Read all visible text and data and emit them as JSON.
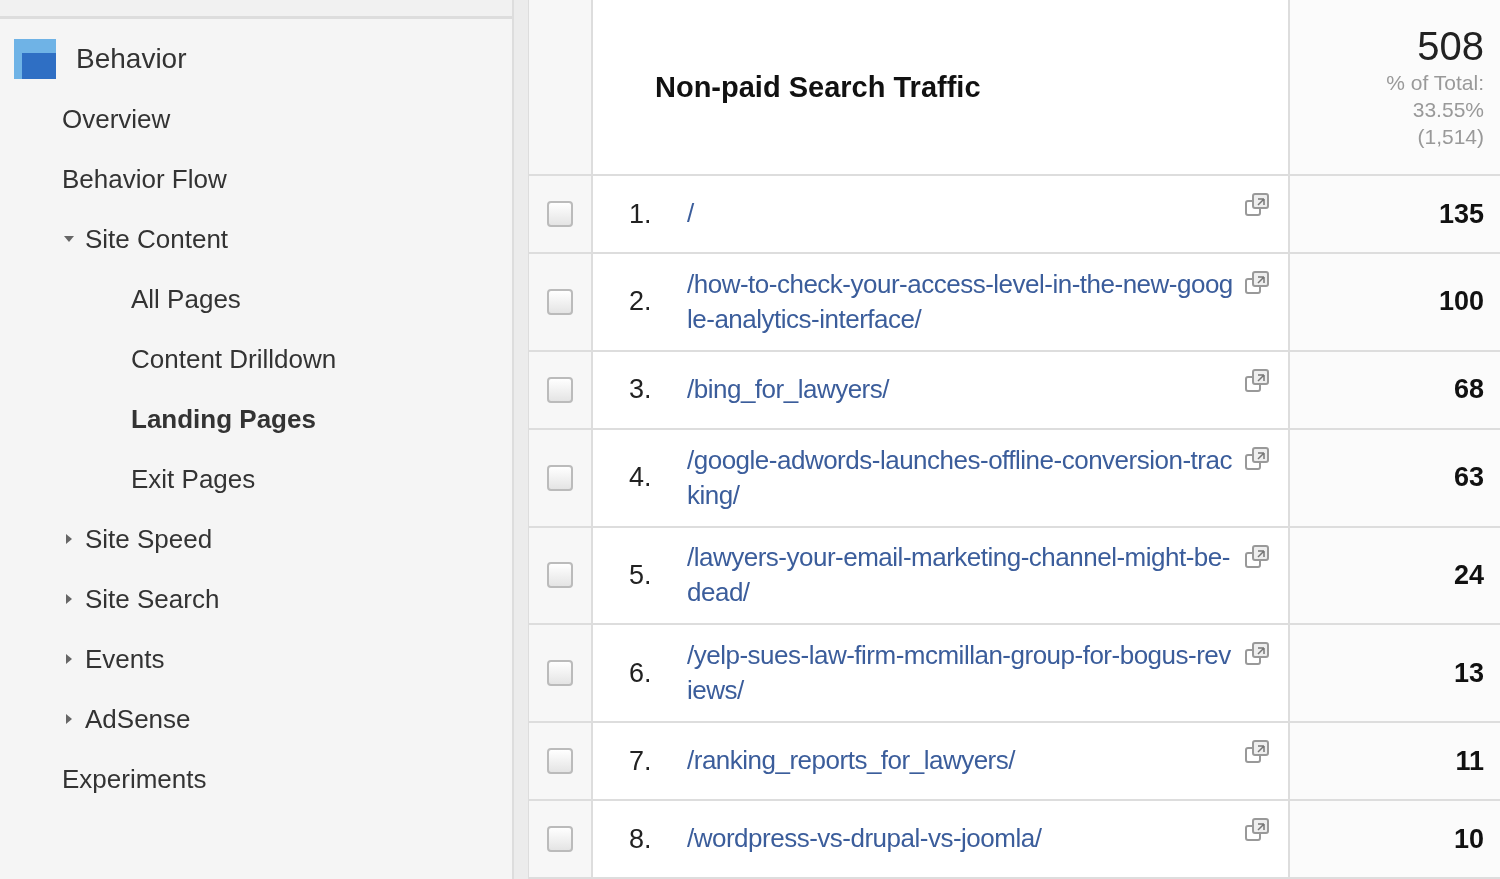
{
  "sidebar": {
    "heading": "Behavior",
    "items": [
      {
        "kind": "link",
        "label": "Overview",
        "selected": false
      },
      {
        "kind": "link",
        "label": "Behavior Flow",
        "selected": false
      },
      {
        "kind": "group",
        "label": "Site Content",
        "expanded": true,
        "selected": false,
        "children": [
          {
            "label": "All Pages",
            "selected": false
          },
          {
            "label": "Content Drilldown",
            "selected": false
          },
          {
            "label": "Landing Pages",
            "selected": true
          },
          {
            "label": "Exit Pages",
            "selected": false
          }
        ]
      },
      {
        "kind": "group",
        "label": "Site Speed",
        "expanded": false,
        "selected": false
      },
      {
        "kind": "group",
        "label": "Site Search",
        "expanded": false,
        "selected": false
      },
      {
        "kind": "group",
        "label": "Events",
        "expanded": false,
        "selected": false
      },
      {
        "kind": "group",
        "label": "AdSense",
        "expanded": false,
        "selected": false
      },
      {
        "kind": "link",
        "label": "Experiments",
        "selected": false
      }
    ]
  },
  "table": {
    "segment": "Non-paid Search Traffic",
    "total": "508",
    "total_share_label": "% of Total:",
    "total_share": "33.55%",
    "total_base": "(1,514)",
    "rows": [
      {
        "rank": "1.",
        "page": "/",
        "value": "135",
        "checked": false
      },
      {
        "rank": "2.",
        "page": "/how-to-check-your-access-level-in-the-new-google-analytics-interface/",
        "value": "100",
        "checked": false
      },
      {
        "rank": "3.",
        "page": "/bing_for_lawyers/",
        "value": "68",
        "checked": false
      },
      {
        "rank": "4.",
        "page": "/google-adwords-launches-offline-conversion-tracking/",
        "value": "63",
        "checked": false
      },
      {
        "rank": "5.",
        "page": "/lawyers-your-email-marketing-channel-might-be-dead/",
        "value": "24",
        "checked": false
      },
      {
        "rank": "6.",
        "page": "/yelp-sues-law-firm-mcmillan-group-for-bogus-reviews/",
        "value": "13",
        "checked": false
      },
      {
        "rank": "7.",
        "page": "/ranking_reports_for_lawyers/",
        "value": "11",
        "checked": false
      },
      {
        "rank": "8.",
        "page": "/wordpress-vs-drupal-vs-joomla/",
        "value": "10",
        "checked": false
      }
    ]
  }
}
